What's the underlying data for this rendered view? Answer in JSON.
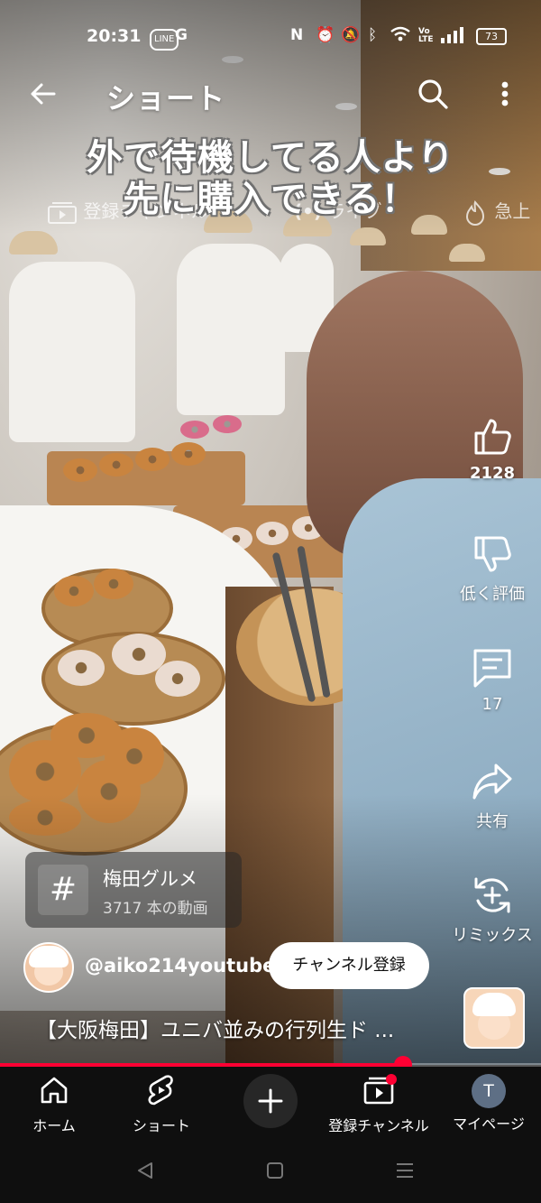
{
  "status_bar": {
    "time": "20:31",
    "left_icons": [
      "line-icon",
      "g-icon"
    ],
    "right_icons": [
      "nfc-icon",
      "alarm-icon",
      "mute-icon",
      "bluetooth-icon",
      "wifi-icon",
      "volte-icon",
      "signal-icon"
    ],
    "battery": "73"
  },
  "header": {
    "title": "ショート"
  },
  "overlay": {
    "line1": "外で待機してる人より",
    "line2": "先に購入できる！"
  },
  "feed_tabs": [
    {
      "label": "登録チャンネル",
      "icon": "subscriptions-icon"
    },
    {
      "label": "ライブ",
      "icon": "live-icon"
    },
    {
      "label": "急上",
      "icon": "trending-icon"
    }
  ],
  "actions": {
    "like_count": "2128",
    "dislike_label": "低く評価",
    "comment_count": "17",
    "share_label": "共有",
    "remix_label": "リミックス"
  },
  "hashtag": {
    "symbol": "#",
    "title": "梅田グルメ",
    "subtitle": "3717 本の動画"
  },
  "channel": {
    "handle": "@aiko214youtube",
    "subscribe_label": "チャンネル登録"
  },
  "video": {
    "title": "【大阪梅田】ユニバ並みの行列生ド ...",
    "progress_fraction": 0.745
  },
  "bottom_nav": [
    {
      "label": "ホーム",
      "icon": "home-icon"
    },
    {
      "label": "ショート",
      "icon": "shorts-icon"
    },
    {
      "label": "",
      "icon": "create-icon"
    },
    {
      "label": "登録チャンネル",
      "icon": "subscriptions-icon"
    },
    {
      "label": "マイページ",
      "icon": "avatar-icon",
      "avatar_letter": "T"
    }
  ],
  "colors": {
    "accent": "#ff0033",
    "nav_bg": "#0f0f0f",
    "subscribe_bg": "#ffffff"
  }
}
